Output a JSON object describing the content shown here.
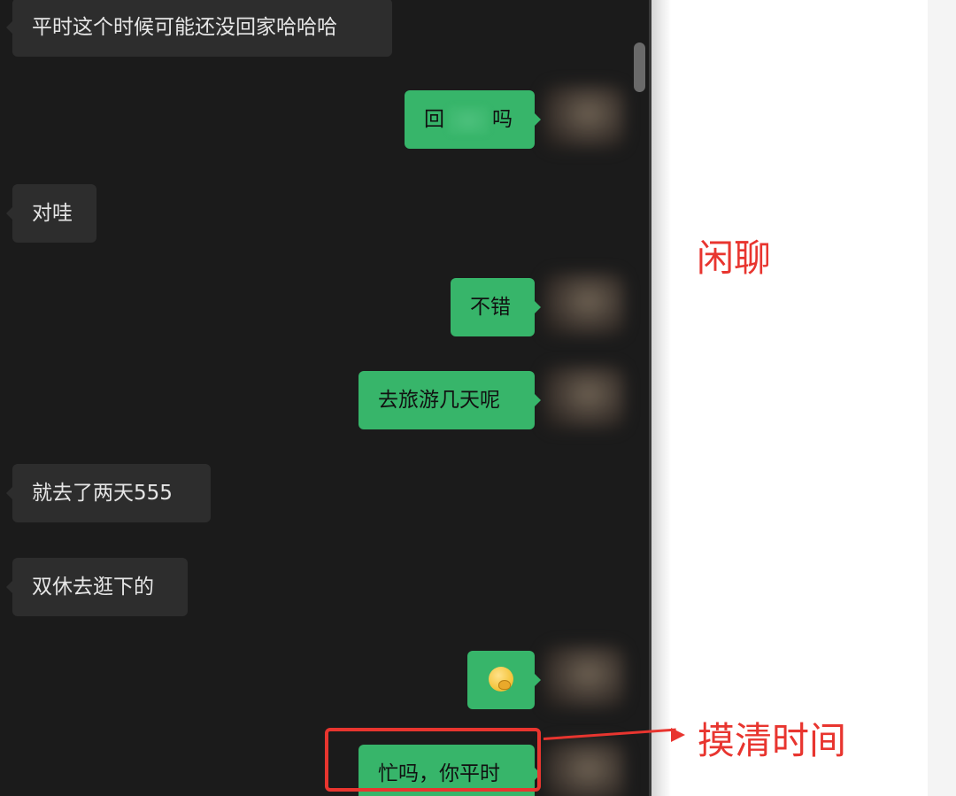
{
  "messages": [
    {
      "dir": "in",
      "text": "平时这个时候可能还没回家哈哈哈"
    },
    {
      "dir": "out",
      "text_before": "回",
      "text_after": "吗",
      "redacted": true
    },
    {
      "dir": "in",
      "text": "对哇"
    },
    {
      "dir": "out",
      "text": "不错"
    },
    {
      "dir": "out",
      "text": "去旅游几天呢"
    },
    {
      "dir": "in",
      "text": "就去了两天555"
    },
    {
      "dir": "in",
      "text": "双休去逛下的"
    },
    {
      "dir": "out",
      "emoji": "thinking-face-emoji"
    },
    {
      "dir": "out",
      "text": "忙吗，你平时"
    }
  ],
  "annotations": {
    "chat_label": "闲聊",
    "time_label": "摸清时间"
  },
  "colors": {
    "chat_background": "#1b1b1b",
    "incoming_bubble": "#2d2d2d",
    "outgoing_bubble": "#37b56a",
    "annotation_red": "#e8352f"
  }
}
